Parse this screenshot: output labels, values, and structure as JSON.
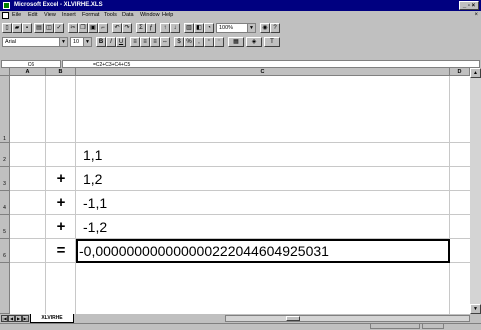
{
  "window": {
    "title": "Microsoft Excel - XLVIRHE.XLS"
  },
  "menu": [
    "Eile",
    "Edit",
    "View",
    "Insert",
    "Format",
    "Tools",
    "Data",
    "Window",
    "Help"
  ],
  "toolbar": {
    "zoom": "100%",
    "font": "Arial",
    "font_size": "10"
  },
  "formula_bar": {
    "cell_ref": "C6",
    "formula": "=C2+C3+C4+C5"
  },
  "columns": [
    "A",
    "B",
    "C",
    "D"
  ],
  "rows": [
    "1",
    "2",
    "3",
    "4",
    "5",
    "6"
  ],
  "cells": {
    "c2": "1,1",
    "b3": "+",
    "c3": "1,2",
    "b4": "+",
    "c4": "-1,1",
    "b5": "+",
    "c5": "-1,2",
    "b6": "=",
    "c6": "-0,000000000000000222044604925031"
  },
  "sheet_tab": "XLVIRHE"
}
